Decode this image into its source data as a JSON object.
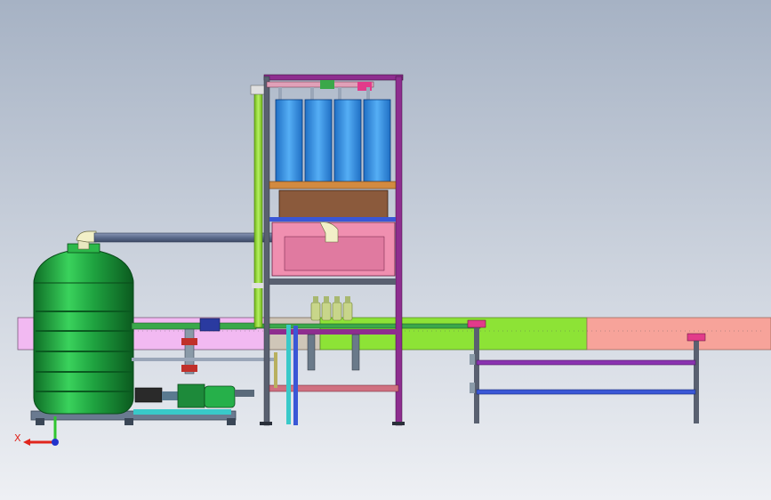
{
  "viewport": {
    "background_top": "#a6b2c4",
    "background_bottom": "#eef0f4"
  },
  "triad": {
    "x_label": "X",
    "x_color": "#e0251c",
    "y_color": "#2fc52f",
    "z_color": "#2233cc"
  },
  "colors": {
    "frame": "#596070",
    "frame_purple": "#8e2d8f",
    "bin_blue": "#2f8fe6",
    "tank_green": "#1fa340",
    "pipe_gray": "#6b7a99",
    "pipe_green": "#8fd42a",
    "conveyor_violet": "#f2b9f2",
    "conveyor_lime": "#8de336",
    "conveyor_salmon": "#f7a39a",
    "conveyor_gray": "#cfc6b8",
    "rail_blue": "#3a57d6",
    "rail_purple": "#8a33b0",
    "machine_pink": "#f08fb0",
    "machine_brown": "#8b5a3c",
    "bottle": "#c8d68a"
  }
}
